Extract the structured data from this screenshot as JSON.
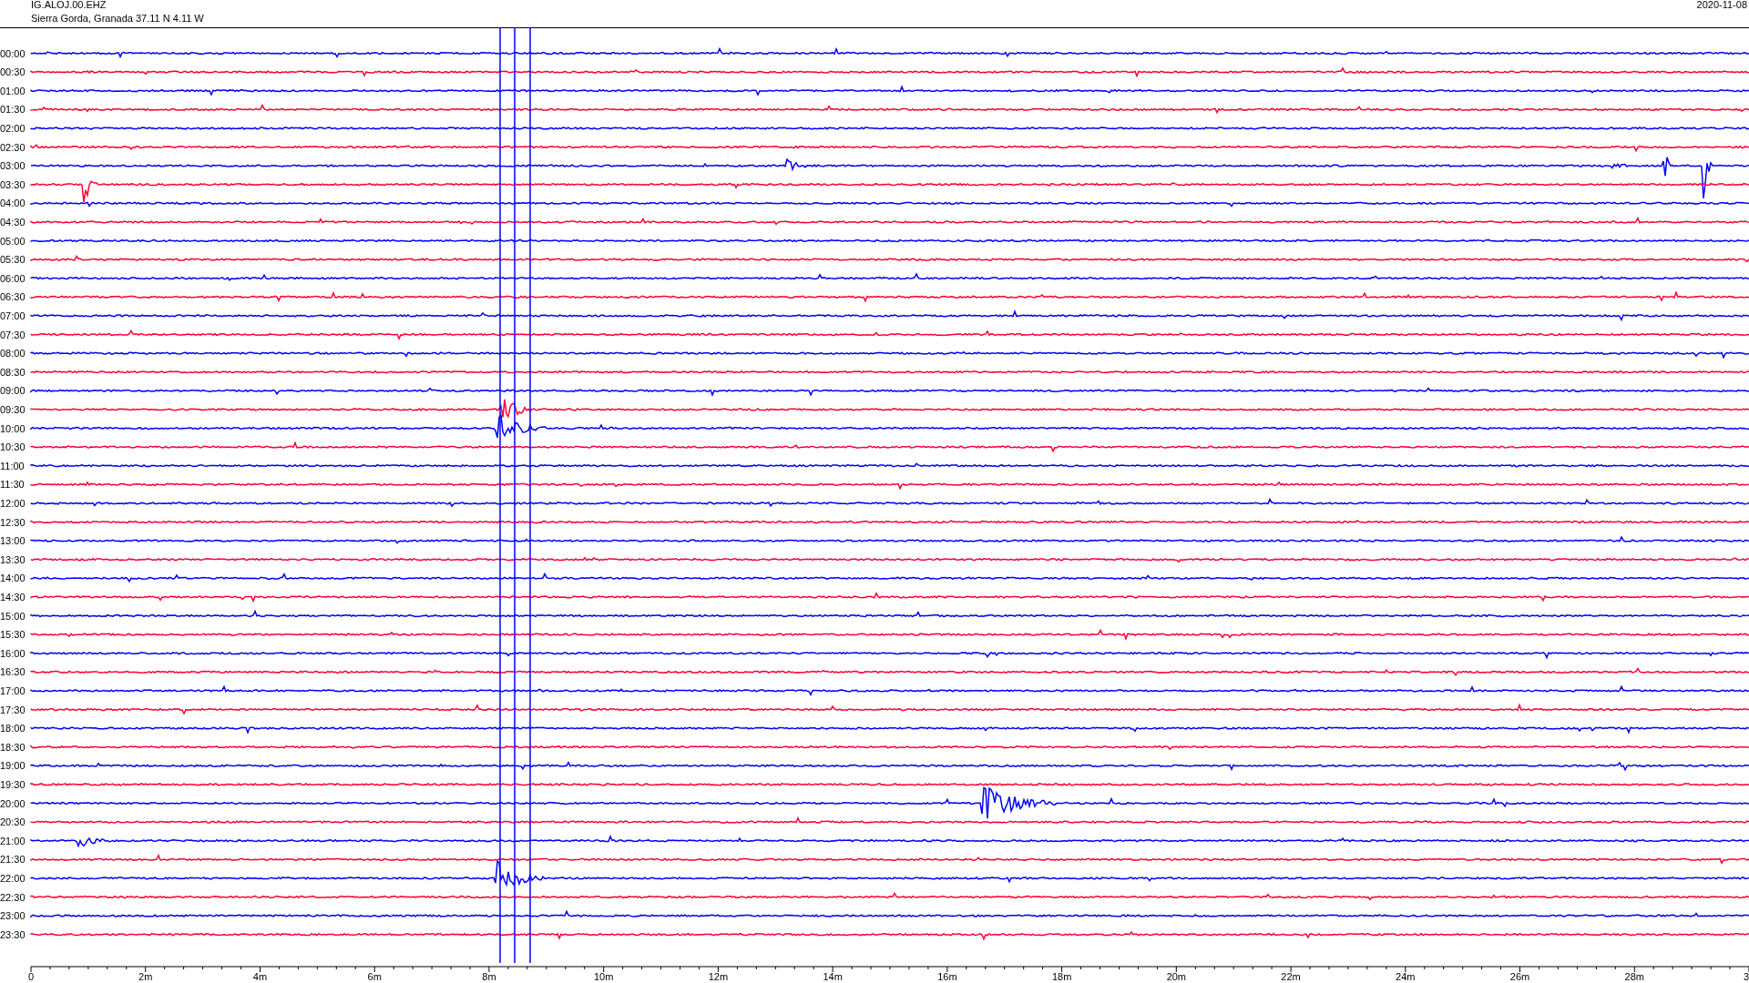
{
  "header": {
    "channel": "IG.ALOJ.00.EHZ",
    "station": "Sierra Gorda, Granada  37.11 N 4.11 W",
    "date": "2020-11-08"
  },
  "rows": [
    {
      "label": "00:00",
      "color": "#0000ff"
    },
    {
      "label": "00:30",
      "color": "#ff0033"
    },
    {
      "label": "01:00",
      "color": "#0000ff"
    },
    {
      "label": "01:30",
      "color": "#ff0033"
    },
    {
      "label": "02:00",
      "color": "#0000ff"
    },
    {
      "label": "02:30",
      "color": "#ff0033"
    },
    {
      "label": "03:00",
      "color": "#0000ff"
    },
    {
      "label": "03:30",
      "color": "#ff0033"
    },
    {
      "label": "04:00",
      "color": "#0000ff"
    },
    {
      "label": "04:30",
      "color": "#ff0033"
    },
    {
      "label": "05:00",
      "color": "#0000ff"
    },
    {
      "label": "05:30",
      "color": "#ff0033"
    },
    {
      "label": "06:00",
      "color": "#0000ff"
    },
    {
      "label": "06:30",
      "color": "#ff0033"
    },
    {
      "label": "07:00",
      "color": "#0000ff"
    },
    {
      "label": "07:30",
      "color": "#ff0033"
    },
    {
      "label": "08:00",
      "color": "#0000ff"
    },
    {
      "label": "08:30",
      "color": "#ff0033"
    },
    {
      "label": "09:00",
      "color": "#0000ff"
    },
    {
      "label": "09:30",
      "color": "#ff0033"
    },
    {
      "label": "10:00",
      "color": "#0000ff"
    },
    {
      "label": "10:30",
      "color": "#ff0033"
    },
    {
      "label": "11:00",
      "color": "#0000ff"
    },
    {
      "label": "11:30",
      "color": "#ff0033"
    },
    {
      "label": "12:00",
      "color": "#0000ff"
    },
    {
      "label": "12:30",
      "color": "#ff0033"
    },
    {
      "label": "13:00",
      "color": "#0000ff"
    },
    {
      "label": "13:30",
      "color": "#ff0033"
    },
    {
      "label": "14:00",
      "color": "#0000ff"
    },
    {
      "label": "14:30",
      "color": "#ff0033"
    },
    {
      "label": "15:00",
      "color": "#0000ff"
    },
    {
      "label": "15:30",
      "color": "#ff0033"
    },
    {
      "label": "16:00",
      "color": "#0000ff"
    },
    {
      "label": "16:30",
      "color": "#ff0033"
    },
    {
      "label": "17:00",
      "color": "#0000ff"
    },
    {
      "label": "17:30",
      "color": "#ff0033"
    },
    {
      "label": "18:00",
      "color": "#0000ff"
    },
    {
      "label": "18:30",
      "color": "#ff0033"
    },
    {
      "label": "19:00",
      "color": "#0000ff"
    },
    {
      "label": "19:30",
      "color": "#ff0033"
    },
    {
      "label": "20:00",
      "color": "#0000ff"
    },
    {
      "label": "20:30",
      "color": "#ff0033"
    },
    {
      "label": "21:00",
      "color": "#0000ff"
    },
    {
      "label": "21:30",
      "color": "#ff0033"
    },
    {
      "label": "22:00",
      "color": "#0000ff"
    },
    {
      "label": "22:30",
      "color": "#ff0033"
    },
    {
      "label": "23:00",
      "color": "#0000ff"
    },
    {
      "label": "23:30",
      "color": "#ff0033"
    }
  ],
  "axis": {
    "ticks": [
      "0",
      "2m",
      "4m",
      "6m",
      "8m",
      "10m",
      "12m",
      "14m",
      "16m",
      "18m",
      "20m",
      "22m",
      "24m",
      "26m",
      "28m",
      "3"
    ]
  }
}
